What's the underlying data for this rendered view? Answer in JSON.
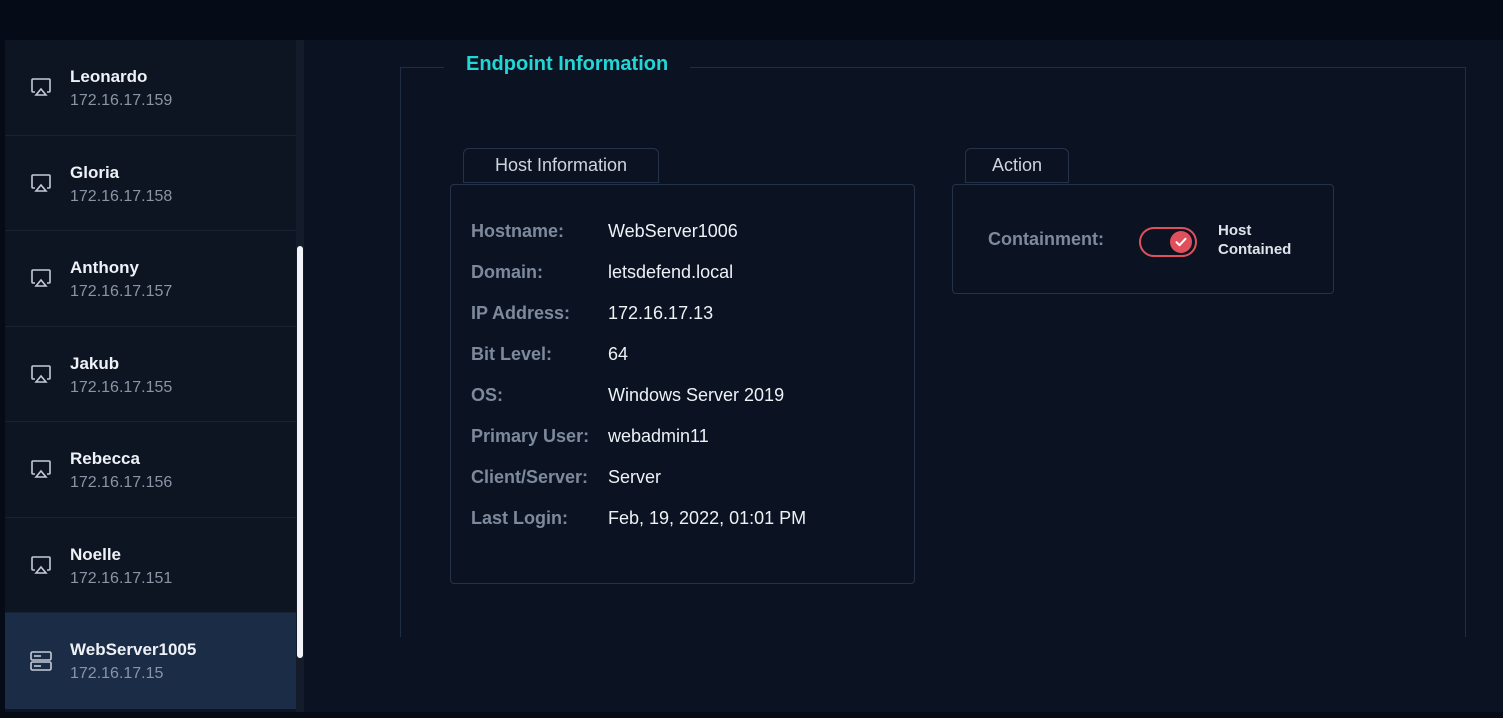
{
  "sidebar": {
    "items": [
      {
        "name": "Leonardo",
        "ip": "172.16.17.159",
        "icon": "monitor-icon"
      },
      {
        "name": "Gloria",
        "ip": "172.16.17.158",
        "icon": "monitor-icon"
      },
      {
        "name": "Anthony",
        "ip": "172.16.17.157",
        "icon": "monitor-icon"
      },
      {
        "name": "Jakub",
        "ip": "172.16.17.155",
        "icon": "monitor-icon"
      },
      {
        "name": "Rebecca",
        "ip": "172.16.17.156",
        "icon": "monitor-icon"
      },
      {
        "name": "Noelle",
        "ip": "172.16.17.151",
        "icon": "monitor-icon"
      },
      {
        "name": "WebServer1005",
        "ip": "172.16.17.15",
        "icon": "server-icon",
        "selected": true
      }
    ]
  },
  "endpoint": {
    "title": "Endpoint Information",
    "host_tab": "Host Information",
    "action_tab": "Action",
    "host": {
      "hostname_label": "Hostname:",
      "hostname": "WebServer1006",
      "domain_label": "Domain:",
      "domain": "letsdefend.local",
      "ip_label": "IP Address:",
      "ip": "172.16.17.13",
      "bit_label": "Bit Level:",
      "bit": "64",
      "os_label": "OS:",
      "os": "Windows Server 2019",
      "user_label": "Primary User:",
      "user": "webadmin11",
      "cs_label": "Client/Server:",
      "cs": "Server",
      "login_label": "Last Login:",
      "login": "Feb, 19, 2022, 01:01 PM"
    },
    "action": {
      "containment_label": "Containment:",
      "containment_on": true,
      "status_line1": "Host",
      "status_line2": "Contained"
    }
  },
  "colors": {
    "accent": "#22d6d6",
    "danger": "#e0505c",
    "selected_bg": "#1b2c46"
  }
}
